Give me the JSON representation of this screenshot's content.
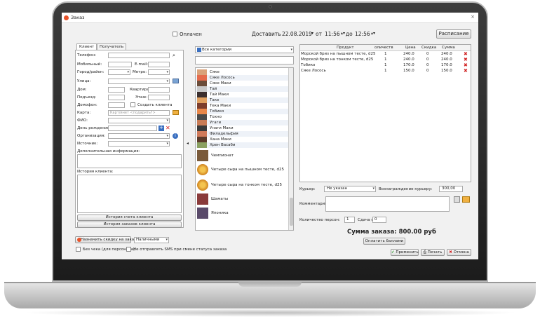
{
  "window": {
    "title": "Заказ",
    "close": "×"
  },
  "top": {
    "paid_label": "Оплачен",
    "deliver_label": "Доставить",
    "date": "22.08.2019",
    "from_label": "от",
    "from_time": "11:56",
    "to_label": "до",
    "to_time": "12:56",
    "schedule_button": "Расписание"
  },
  "tabs": [
    "Клиент",
    "Получатель"
  ],
  "client_form": {
    "phone": "Телефон:",
    "mobile": "Мобильный:",
    "email": "E-mail:",
    "city": "Город/район:",
    "metro": "Метро:",
    "street": "Улица:",
    "house": "Дом:",
    "apartment": "Квартира:",
    "entrance": "Подъезд:",
    "floor": "Этаж:",
    "intercom": "Домофон:",
    "create_client": "Создать клиента",
    "card": "Карта:",
    "card_placeholder": "Карт/инет <подарить?>",
    "fio": "ФИО:",
    "birthday": "День рождения:",
    "organization": "Организация:",
    "source": "Источник:",
    "extra_info": "Дополнительная информация:",
    "client_history": "История клиента:",
    "account_history_button": "История счета клиента",
    "order_history_button": "История заказов клиента",
    "discount_button": "Назначить скидку на заказ",
    "payment_method": "Наличными",
    "no_check": "Без чека (для персонала)",
    "no_sms": "Не отправлять SMS при смене статуса заказа"
  },
  "categories": {
    "selected": "Все категории",
    "items": [
      "Сяке",
      "Сяке Лосось",
      "Сяке Маки",
      "Тай",
      "Тай Маки",
      "Таке",
      "Тека Маки",
      "Тобико",
      "Тохно",
      "Угаги",
      "Унаги Маки",
      "Филадельфия",
      "Хана Маки",
      "Хрен Васаби"
    ],
    "big_items": [
      "Чемпионат",
      "Четыре сыра на пышном тесте, d25",
      "Четыре сыра на тонком тесте, d25",
      "Шаматы",
      "Японика"
    ]
  },
  "order_table": {
    "columns": [
      "Продукт",
      "оличеств",
      "Цена",
      "Скидка",
      "Сумма"
    ],
    "rows": [
      {
        "product": "Морской бриз на пышном тесте, d25",
        "qty": "1",
        "price": "240.0",
        "discount": "0",
        "sum": "240.0"
      },
      {
        "product": "Морской бриз на тонком тесте, d25",
        "qty": "1",
        "price": "240.0",
        "discount": "0",
        "sum": "240.0"
      },
      {
        "product": "Тобико",
        "qty": "1",
        "price": "170.0",
        "discount": "0",
        "sum": "170.0"
      },
      {
        "product": "Сяке Лосось",
        "qty": "1",
        "price": "150.0",
        "discount": "0",
        "sum": "150.0"
      }
    ]
  },
  "courier": {
    "label": "Курьер:",
    "value": "Не указан",
    "reward_label": "Вознаграждение курьеру:",
    "reward_value": "300,00"
  },
  "comment_label": "Комментарий:",
  "persons": {
    "label": "Количество персон:",
    "value": "1",
    "change_label": "Сдача с",
    "change_value": "0"
  },
  "total": {
    "label": "Сумма заказа: 800.00 руб",
    "pay_bonus_button": "Оплатить баллами"
  },
  "actions": {
    "apply": "Применить",
    "print": "Печать",
    "cancel": "Отмена"
  },
  "colors": {
    "accent": "#e8532a",
    "delete": "#d02020",
    "selection": "#dde4f0"
  }
}
